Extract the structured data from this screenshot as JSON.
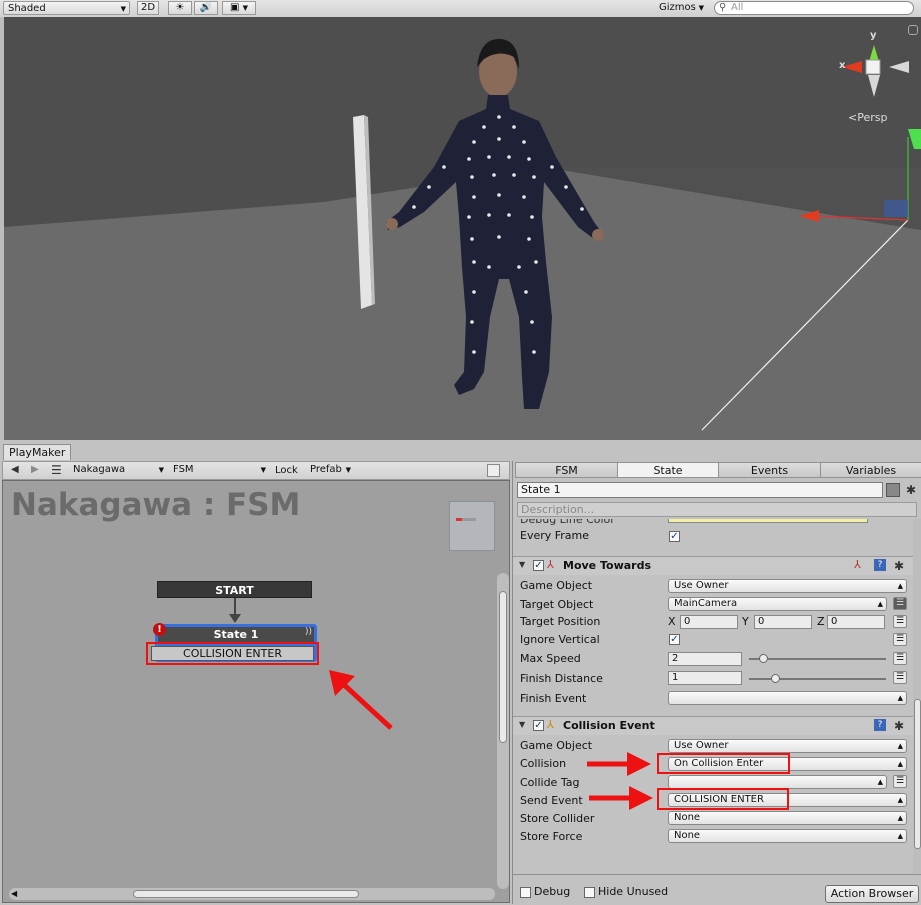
{
  "scene_toolbar": {
    "shading_mode": "Shaded",
    "mode_2d": "2D",
    "gizmos_label": "Gizmos",
    "search_placeholder": "All"
  },
  "viewport": {
    "persp_label": "Persp",
    "axis_x": "x",
    "axis_y": "y"
  },
  "playmaker": {
    "tab_label": "PlayMaker",
    "toolbar": {
      "object_select": "Nakagawa",
      "fsm_select": "FSM",
      "lock_label": "Lock",
      "prefab_label": "Prefab"
    },
    "graph": {
      "title": "Nakagawa : FSM",
      "start_label": "START",
      "state_name": "State 1",
      "state_warning": "!",
      "state_event": "COLLISION ENTER"
    }
  },
  "inspector": {
    "tabs": [
      "FSM",
      "State",
      "Events",
      "Variables"
    ],
    "active_tab": "State",
    "state_name": "State 1",
    "description_placeholder": "Description...",
    "partial_row": "Debug Line Color",
    "every_frame_label": "Every Frame",
    "move_towards": {
      "title": "Move Towards",
      "game_object_label": "Game Object",
      "game_object_value": "Use Owner",
      "target_object_label": "Target Object",
      "target_object_value": "MainCamera",
      "target_position_label": "Target Position",
      "x_label": "X",
      "x_value": "0",
      "y_label": "Y",
      "y_value": "0",
      "z_label": "Z",
      "z_value": "0",
      "ignore_vertical_label": "Ignore Vertical",
      "max_speed_label": "Max Speed",
      "max_speed_value": "2",
      "finish_distance_label": "Finish Distance",
      "finish_distance_value": "1",
      "finish_event_label": "Finish Event",
      "finish_event_value": ""
    },
    "collision_event": {
      "title": "Collision Event",
      "game_object_label": "Game Object",
      "game_object_value": "Use Owner",
      "collision_label": "Collision",
      "collision_value": "On Collision Enter",
      "collide_tag_label": "Collide Tag",
      "collide_tag_value": "",
      "send_event_label": "Send Event",
      "send_event_value": "COLLISION ENTER",
      "store_collider_label": "Store Collider",
      "store_collider_value": "None",
      "store_force_label": "Store Force",
      "store_force_value": "None"
    },
    "bottom": {
      "debug_label": "Debug",
      "hide_unused_label": "Hide Unused",
      "action_browser_label": "Action Browser"
    }
  },
  "colors": {
    "highlight_red": "#ee1111",
    "state_selected_blue": "#3a6fe0"
  }
}
